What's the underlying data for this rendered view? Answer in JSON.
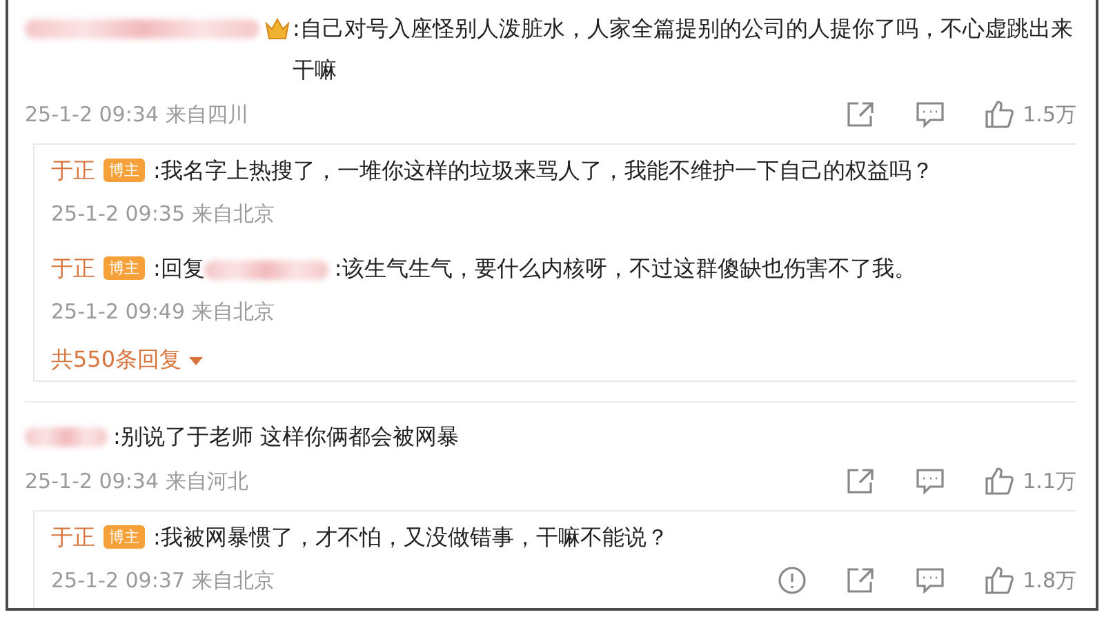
{
  "comments": [
    {
      "author_verified": true,
      "text": ":自己对号入座怪别人泼脏水，人家全篇提别的公司的人提你了吗，不心虚跳出来干嘛",
      "time": "25-1-2 09:34",
      "location": "来自四川",
      "actions": [
        {
          "kind": "share"
        },
        {
          "kind": "comment"
        },
        {
          "kind": "like"
        }
      ],
      "likes": "1.5万",
      "replies": [
        {
          "author": "于正",
          "badge": "博主",
          "text": ":我名字上热搜了，一堆你这样的垃圾来骂人了，我能不维护一下自己的权益吗？",
          "time": "25-1-2 09:35",
          "location": "来自北京"
        },
        {
          "author": "于正",
          "badge": "博主",
          "reply_prefix": ":回复",
          "text": ":该生气生气，要什么内核呀，不过这群傻缺也伤害不了我。",
          "time": "25-1-2 09:49",
          "location": "来自北京"
        }
      ],
      "more_replies": "共550条回复"
    },
    {
      "author_verified": false,
      "text": ":别说了于老师 这样你俩都会被网暴",
      "time": "25-1-2 09:34",
      "location": "来自河北",
      "actions": [
        {
          "kind": "share"
        },
        {
          "kind": "comment"
        },
        {
          "kind": "like"
        }
      ],
      "likes": "1.1万",
      "replies": [
        {
          "author": "于正",
          "badge": "博主",
          "text": ":我被网暴惯了，才不怕，又没做错事，干嘛不能说？",
          "time": "25-1-2 09:37",
          "location": "来自北京",
          "actions": [
            {
              "kind": "report"
            },
            {
              "kind": "share"
            },
            {
              "kind": "comment"
            },
            {
              "kind": "like"
            }
          ],
          "likes": "1.8万"
        }
      ]
    }
  ]
}
